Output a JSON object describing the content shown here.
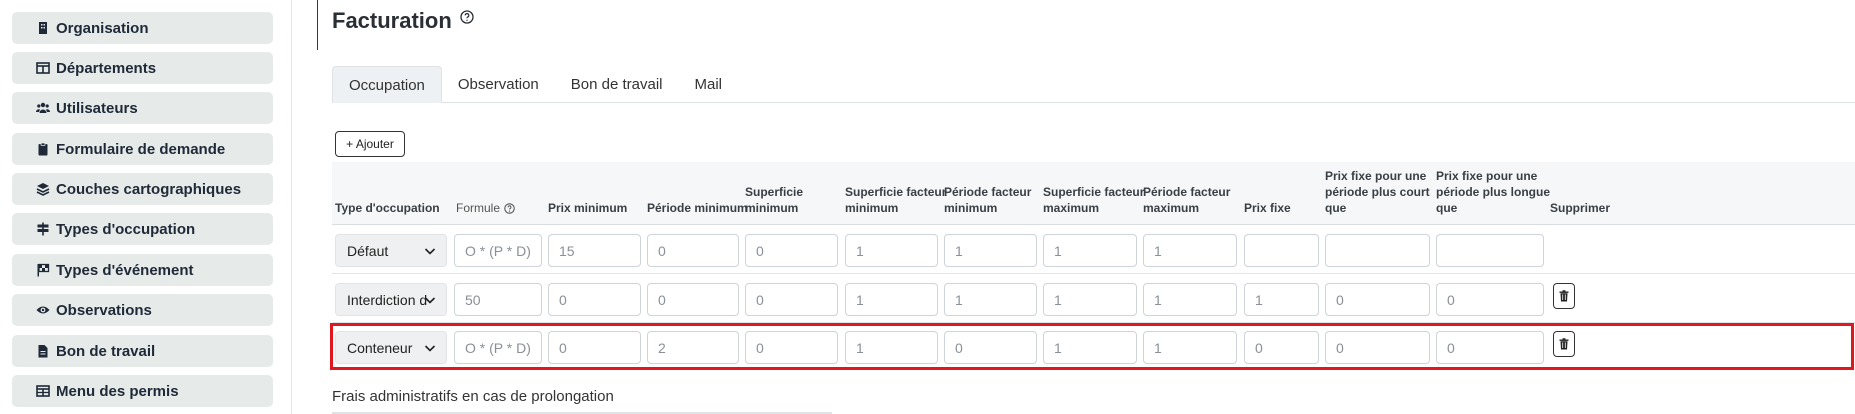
{
  "sidebar": {
    "items": [
      {
        "label": "Organisation",
        "icon": "building-icon"
      },
      {
        "label": "Départements",
        "icon": "table-icon"
      },
      {
        "label": "Utilisateurs",
        "icon": "users-icon"
      },
      {
        "label": "Formulaire de demande",
        "icon": "clipboard-icon"
      },
      {
        "label": "Couches cartographiques",
        "icon": "layers-icon"
      },
      {
        "label": "Types d'occupation",
        "icon": "signpost-icon"
      },
      {
        "label": "Types d'événement",
        "icon": "flag-icon"
      },
      {
        "label": "Observations",
        "icon": "eye-icon"
      },
      {
        "label": "Bon de travail",
        "icon": "file-icon"
      },
      {
        "label": "Menu des permis",
        "icon": "table-icon"
      }
    ]
  },
  "page": {
    "title": "Facturation"
  },
  "tabs": [
    "Occupation",
    "Observation",
    "Bon de travail",
    "Mail"
  ],
  "add_button": "+ Ajouter",
  "table": {
    "headers": {
      "type": "Type d'occupation",
      "formula": "Formule",
      "min_price": "Prix minimum",
      "min_period": "Période minimum",
      "min_area_1": "Superficie",
      "min_area_2": "minimum",
      "min_area_factor_1": "Superficie facteur",
      "min_area_factor_2": "minimum",
      "min_period_factor_1": "Période facteur",
      "min_period_factor_2": "minimum",
      "max_area_factor_1": "Superficie facteur",
      "max_area_factor_2": "maximum",
      "max_period_factor_1": "Période facteur",
      "max_period_factor_2": "maximum",
      "fixed_price": "Prix fixe",
      "short_period_1": "Prix fixe pour une",
      "short_period_2": "période plus court",
      "short_period_3": "que",
      "long_period_1": "Prix fixe pour une",
      "long_period_2": "période plus longue",
      "long_period_3": "que",
      "delete": "Supprimer"
    },
    "rows": [
      {
        "type": "Défaut",
        "formula": "O * (P * D)",
        "min_price": "15",
        "min_period": "0",
        "min_area": "0",
        "min_area_factor": "1",
        "min_period_factor": "1",
        "max_area_factor": "1",
        "max_period_factor": "1",
        "fixed_price": "",
        "short_period": "",
        "long_period": ""
      },
      {
        "type": "Interdiction d",
        "formula": "50",
        "min_price": "0",
        "min_period": "0",
        "min_area": "0",
        "min_area_factor": "1",
        "min_period_factor": "1",
        "max_area_factor": "1",
        "max_period_factor": "1",
        "fixed_price": "1",
        "short_period": "0",
        "long_period": "0"
      },
      {
        "type": "Conteneur",
        "formula": "O * (P * D)",
        "min_price": "0",
        "min_period": "2",
        "min_area": "0",
        "min_area_factor": "1",
        "min_period_factor": "0",
        "max_area_factor": "1",
        "max_period_factor": "1",
        "fixed_price": "0",
        "short_period": "0",
        "long_period": "0"
      }
    ]
  },
  "footer": {
    "label": "Frais administratifs en cas de prolongation"
  },
  "colors": {
    "highlight": "#e0171f",
    "sidebar_bg": "#e6ebea"
  }
}
